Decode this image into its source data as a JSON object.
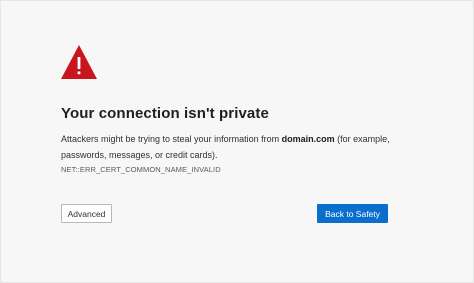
{
  "warning": {
    "icon": "warning-triangle-icon",
    "color": "#c9151e"
  },
  "title": "Your connection isn't private",
  "description": {
    "before": "Attackers might be trying to steal your information from ",
    "domain": "domain.com",
    "after": " (for example, passwords, messages, or credit cards)."
  },
  "error_code": "NET::ERR_CERT_COMMON_NAME_INVALID",
  "buttons": {
    "advanced": "Advanced",
    "back_to_safety": "Back to Safety"
  },
  "colors": {
    "primary_button": "#0a6ecd",
    "background": "#f7f7f7"
  }
}
